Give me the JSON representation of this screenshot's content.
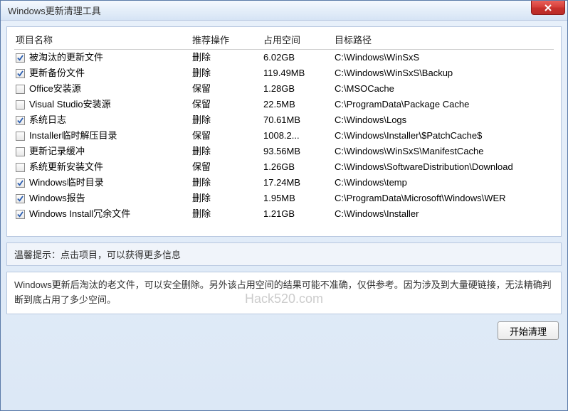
{
  "window": {
    "title": "Windows更新清理工具"
  },
  "columns": {
    "name": "项目名称",
    "action": "推荐操作",
    "size": "占用空间",
    "path": "目标路径"
  },
  "rows": [
    {
      "checked": true,
      "name": "被淘汰的更新文件",
      "action": "删除",
      "size": "6.02GB",
      "path": "C:\\Windows\\WinSxS"
    },
    {
      "checked": true,
      "name": "更新备份文件",
      "action": "删除",
      "size": "119.49MB",
      "path": "C:\\Windows\\WinSxS\\Backup"
    },
    {
      "checked": false,
      "name": "Office安装源",
      "action": "保留",
      "size": "1.28GB",
      "path": "C:\\MSOCache"
    },
    {
      "checked": false,
      "name": "Visual Studio安装源",
      "action": "保留",
      "size": "22.5MB",
      "path": "C:\\ProgramData\\Package Cache"
    },
    {
      "checked": true,
      "name": "系统日志",
      "action": "删除",
      "size": "70.61MB",
      "path": "C:\\Windows\\Logs"
    },
    {
      "checked": false,
      "name": "Installer临时解压目录",
      "action": "保留",
      "size": "1008.2...",
      "path": "C:\\Windows\\Installer\\$PatchCache$"
    },
    {
      "checked": false,
      "name": "更新记录缓冲",
      "action": "删除",
      "size": "93.56MB",
      "path": "C:\\Windows\\WinSxS\\ManifestCache"
    },
    {
      "checked": false,
      "name": "系统更新安装文件",
      "action": "保留",
      "size": "1.26GB",
      "path": "C:\\Windows\\SoftwareDistribution\\Download"
    },
    {
      "checked": true,
      "name": "Windows临时目录",
      "action": "删除",
      "size": "17.24MB",
      "path": "C:\\Windows\\temp"
    },
    {
      "checked": true,
      "name": "Windows报告",
      "action": "删除",
      "size": "1.95MB",
      "path": "C:\\ProgramData\\Microsoft\\Windows\\WER"
    },
    {
      "checked": true,
      "name": "Windows Install冗余文件",
      "action": "删除",
      "size": "1.21GB",
      "path": "C:\\Windows\\Installer"
    }
  ],
  "hint": "温馨提示：点击项目，可以获得更多信息",
  "description": "Windows更新后淘汰的老文件，可以安全删除。另外该占用空间的结果可能不准确，仅供参考。因为涉及到大量硬链接，无法精确判断到底占用了多少空间。",
  "watermark": "Hack520.com",
  "buttons": {
    "start": "开始清理"
  }
}
